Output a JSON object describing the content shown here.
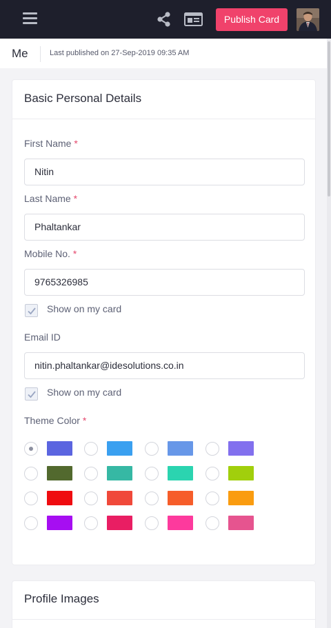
{
  "topbar": {
    "menu_icon": "hamburger-menu-icon",
    "share_icon": "share-icon",
    "card_icon": "id-card-icon",
    "publish_label": "Publish Card",
    "publish_color": "#f0426b",
    "bar_color": "#1e1f2c"
  },
  "header": {
    "title": "Me",
    "last_published": "Last published on 27-Sep-2019 09:35 AM"
  },
  "basic_details": {
    "title": "Basic Personal Details",
    "first_name": {
      "label": "First Name",
      "required": "*",
      "value": "Nitin"
    },
    "last_name": {
      "label": "Last Name",
      "required": "*",
      "value": "Phaltankar"
    },
    "mobile": {
      "label": "Mobile No.",
      "required": "*",
      "value": "9765326985",
      "show_label": "Show on my card",
      "show_checked": true
    },
    "email": {
      "label": "Email ID",
      "value": "nitin.phaltankar@idesolutions.co.in",
      "show_label": "Show on my card",
      "show_checked": true
    },
    "theme_color": {
      "label": "Theme Color",
      "required": "*",
      "selected_index": 0,
      "colors": [
        "#5b65e0",
        "#3aa0f0",
        "#6797e8",
        "#8270ee",
        "#52692e",
        "#36b8a4",
        "#2bd4b0",
        "#a1cf0c",
        "#ef0c10",
        "#f0493a",
        "#f65d2a",
        "#fa9c10",
        "#a60ef2",
        "#e91e63",
        "#fd3a9d",
        "#e6548f"
      ]
    }
  },
  "profile_images": {
    "title": "Profile Images"
  }
}
